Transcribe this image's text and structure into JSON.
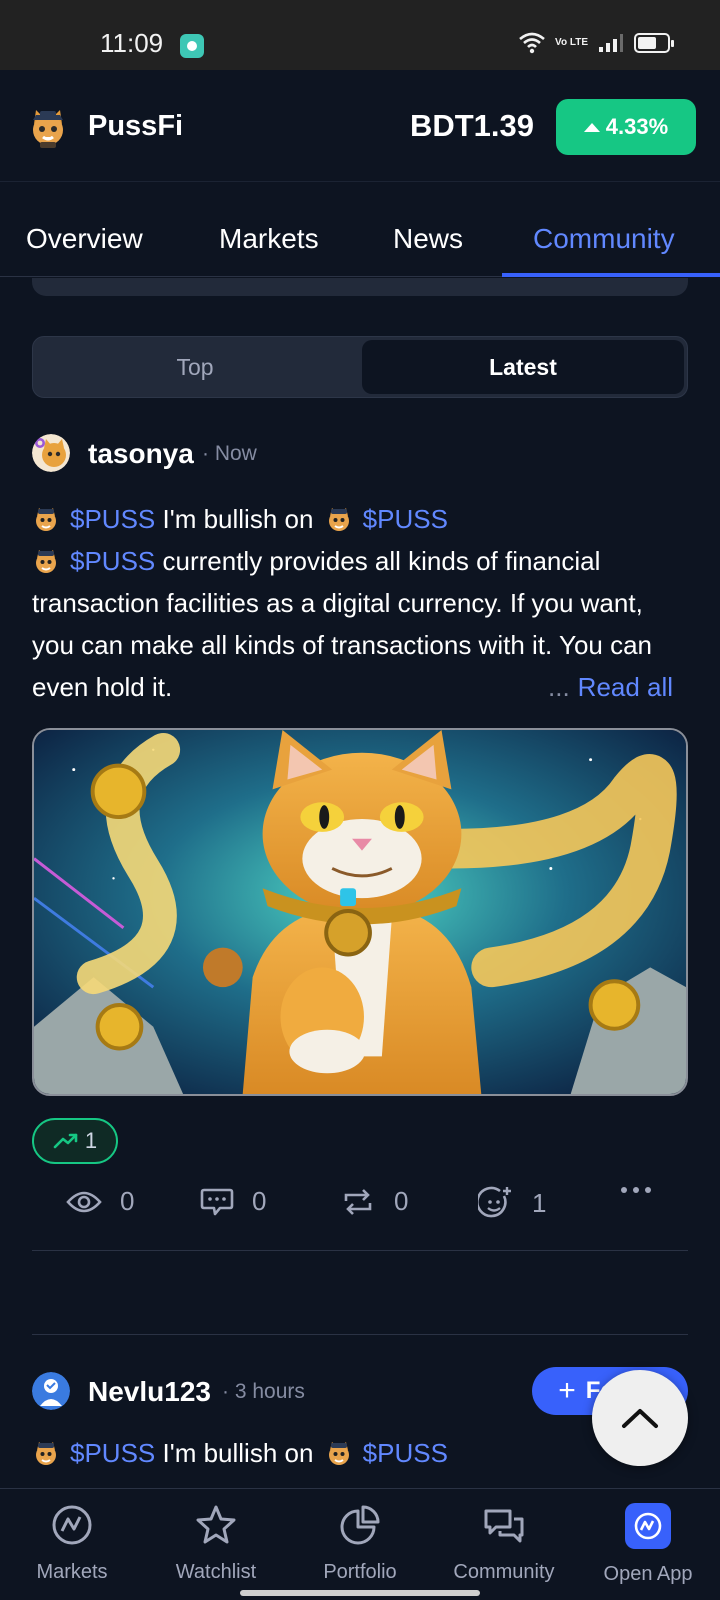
{
  "status_bar": {
    "time": "11:09",
    "network_label": "Vo LTE",
    "icons": [
      "chat-app-icon",
      "wifi-icon",
      "signal-icon",
      "battery-icon"
    ]
  },
  "header": {
    "coin_name": "PussFi",
    "price": "BDT1.39",
    "change": "4.33%",
    "change_color": "#16c784"
  },
  "tabs": {
    "items": [
      "Overview",
      "Markets",
      "News",
      "Community"
    ],
    "active": "Community",
    "accent_color": "#3861fb"
  },
  "feed_toggle": {
    "top_label": "Top",
    "latest_label": "Latest",
    "selected": "Latest"
  },
  "posts": [
    {
      "username": "tasonya",
      "time": "Now",
      "cashtag": "$PUSS",
      "line1_text": "I'm bullish on",
      "body_text": "currently provides all kinds of financial transaction facilities as a digital currency. If you want, you can make all kinds of transactions with it. You can even hold it.",
      "read_all": "Read all",
      "ellipsis": "...",
      "bullish_count": "1",
      "stats": {
        "views": "0",
        "comments": "0",
        "reposts": "0",
        "reactions": "1"
      }
    },
    {
      "username": "Nevlu123",
      "time": "3 hours",
      "follow_label": "Follow",
      "cashtag": "$PUSS",
      "line1_text": "I'm bullish on"
    }
  ],
  "bottom_nav": {
    "markets": "Markets",
    "watchlist": "Watchlist",
    "portfolio": "Portfolio",
    "community": "Community",
    "open_app": "Open App"
  }
}
